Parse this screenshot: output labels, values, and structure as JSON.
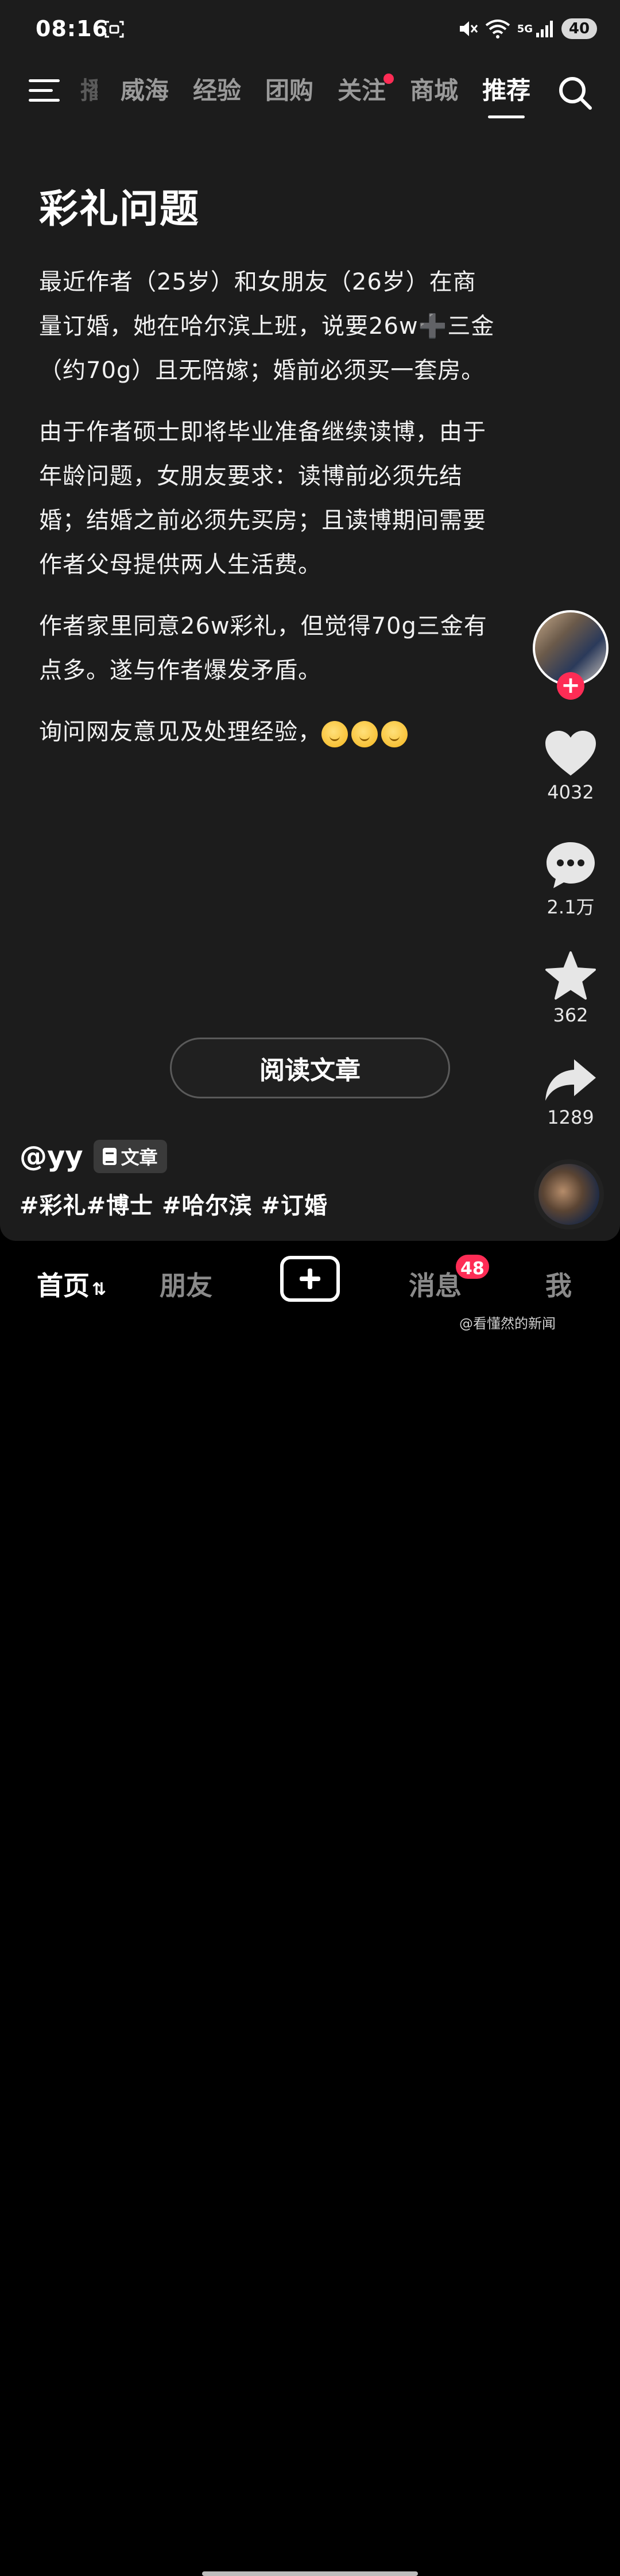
{
  "status_bar": {
    "time": "08:16",
    "network": "5G",
    "battery": "40"
  },
  "top_nav": {
    "tabs": [
      {
        "label": "播",
        "state": "faded"
      },
      {
        "label": "威海",
        "state": "normal"
      },
      {
        "label": "经验",
        "state": "normal"
      },
      {
        "label": "团购",
        "state": "normal"
      },
      {
        "label": "关注",
        "state": "notify"
      },
      {
        "label": "商城",
        "state": "normal"
      },
      {
        "label": "推荐",
        "state": "active"
      }
    ]
  },
  "article": {
    "title": "彩礼问题",
    "paragraphs": [
      " 最近作者（25岁）和女朋友（26岁）在商量订婚，她在哈尔滨上班，说要26w➕三金（约70g）且无陪嫁；婚前必须买一套房。",
      " 由于作者硕士即将毕业准备继续读博，由于年龄问题，女朋友要求：读博前必须先结婚；结婚之前必须先买房；且读博期间需要作者父母提供两人生活费。",
      "作者家里同意26w彩礼，但觉得70g三金有点多。遂与作者爆发矛盾。"
    ],
    "last_line": "询问网友意见及处理经验，"
  },
  "actions": {
    "like_count": "4032",
    "comment_count": "2.1万",
    "favorite_count": "362",
    "share_count": "1289"
  },
  "post": {
    "read_button": "阅读文章",
    "author": "@yy",
    "badge": "文章",
    "hashtags": "#彩礼#博士 #哈尔滨 #订婚"
  },
  "bottom_bar": {
    "home": "首页",
    "friends": "朋友",
    "messages": "消息",
    "messages_badge": "48",
    "me": "我"
  },
  "watermark": "@看懂然的新闻",
  "colors": {
    "accent": "#fe2c55",
    "background": "#1c1c1c"
  }
}
